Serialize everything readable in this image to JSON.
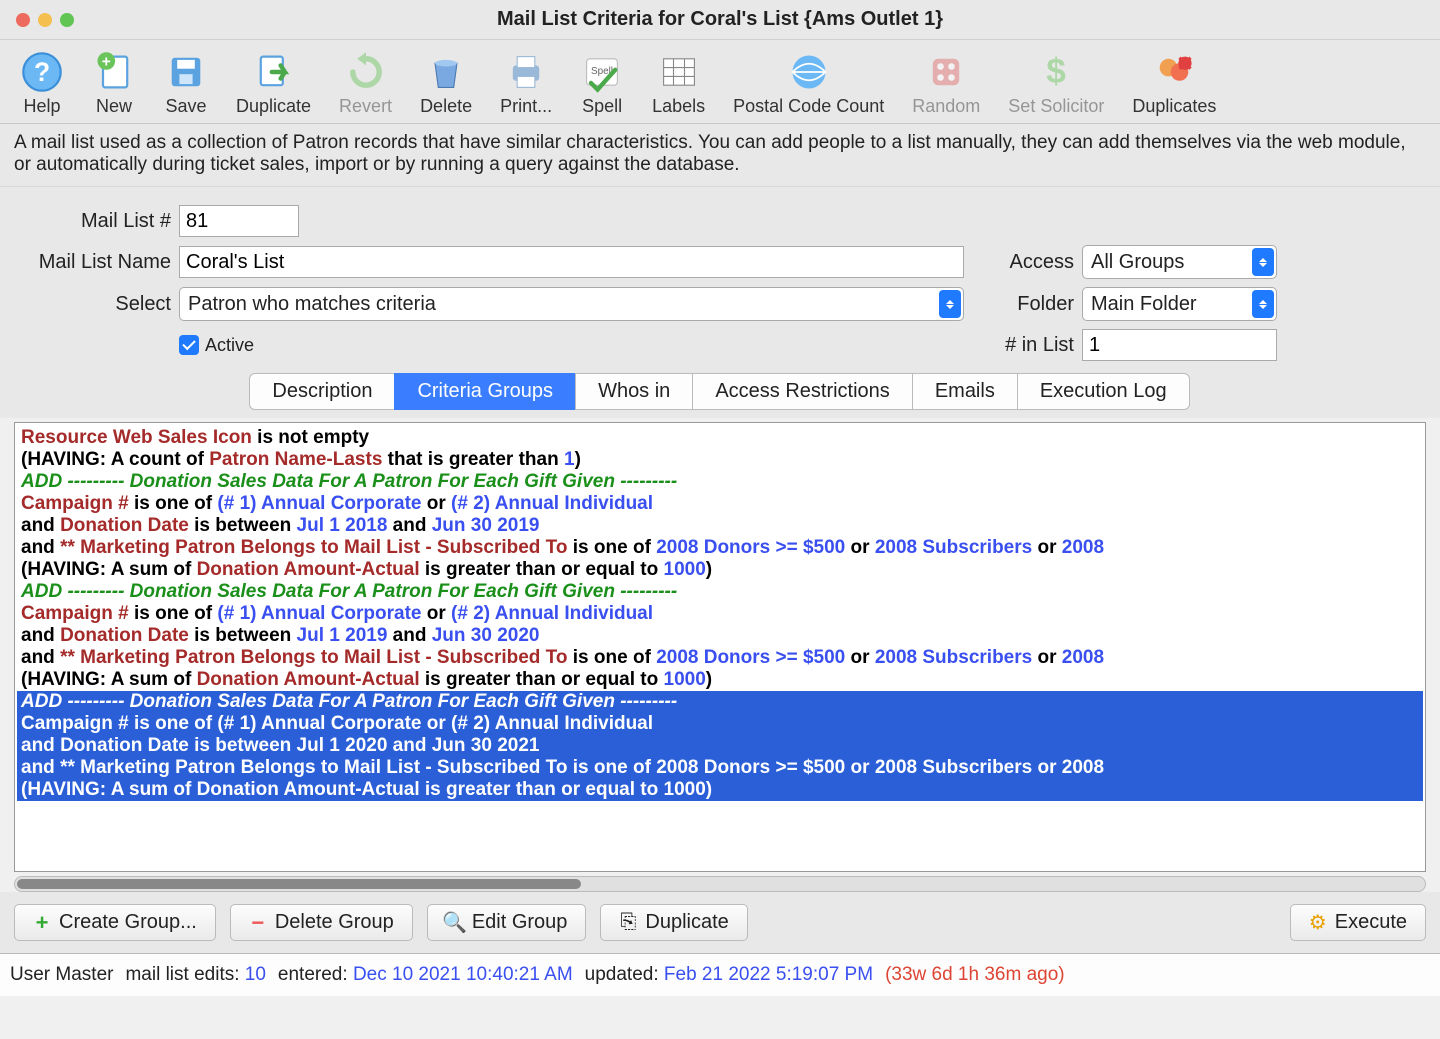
{
  "window": {
    "title": "Mail List Criteria for Coral's List {Ams Outlet 1}"
  },
  "toolbar": [
    {
      "id": "help",
      "label": "Help",
      "disabled": false
    },
    {
      "id": "new",
      "label": "New",
      "disabled": false
    },
    {
      "id": "save",
      "label": "Save",
      "disabled": false
    },
    {
      "id": "duplicate",
      "label": "Duplicate",
      "disabled": false
    },
    {
      "id": "revert",
      "label": "Revert",
      "disabled": true
    },
    {
      "id": "delete",
      "label": "Delete",
      "disabled": false
    },
    {
      "id": "print",
      "label": "Print...",
      "disabled": false
    },
    {
      "id": "spell",
      "label": "Spell",
      "disabled": false
    },
    {
      "id": "labels",
      "label": "Labels",
      "disabled": false
    },
    {
      "id": "postal",
      "label": "Postal Code Count",
      "disabled": false
    },
    {
      "id": "random",
      "label": "Random",
      "disabled": true
    },
    {
      "id": "setsolicitor",
      "label": "Set Solicitor",
      "disabled": true
    },
    {
      "id": "duplicates",
      "label": "Duplicates",
      "disabled": false
    }
  ],
  "description": "A mail list used as a collection of Patron records that have similar characteristics.   You can add people to a list manually, they can add themselves via the web module, or automatically during ticket sales, import or by running a query against the database.",
  "form": {
    "mail_list_num_label": "Mail List #",
    "mail_list_num": "81",
    "mail_list_name_label": "Mail List Name",
    "mail_list_name": "Coral's List",
    "select_label": "Select",
    "select_value": "Patron who matches criteria",
    "access_label": "Access",
    "access_value": "All Groups",
    "folder_label": "Folder",
    "folder_value": "Main Folder",
    "active_label": "Active",
    "active_checked": true,
    "inlist_label": "# in List",
    "inlist_value": "1"
  },
  "tabs": [
    "Description",
    "Criteria Groups",
    "Whos in",
    "Access Restrictions",
    "Emails",
    "Execution Log"
  ],
  "active_tab": "Criteria Groups",
  "criteria_lines": [
    {
      "sel": false,
      "parts": [
        {
          "c": "brown",
          "t": "Resource Web Sales Icon"
        },
        {
          "c": "black",
          "t": " is not empty"
        }
      ]
    },
    {
      "sel": false,
      "parts": [
        {
          "c": "black",
          "t": "("
        },
        {
          "c": "black",
          "t": "HAVING:"
        },
        {
          "c": "black",
          "t": " A count of "
        },
        {
          "c": "brown",
          "t": "Patron Name-Lasts"
        },
        {
          "c": "black",
          "t": " that is greater than "
        },
        {
          "c": "blue",
          "t": "1"
        },
        {
          "c": "black",
          "t": ")"
        }
      ]
    },
    {
      "sel": false,
      "parts": [
        {
          "c": "green",
          "t": "ADD"
        },
        {
          "c": "green",
          "t": "     ---------  Donation Sales Data For A Patron For Each Gift Given ---------"
        }
      ]
    },
    {
      "sel": false,
      "parts": [
        {
          "c": "brown",
          "t": "Campaign #"
        },
        {
          "c": "black",
          "t": " is one of "
        },
        {
          "c": "blue",
          "t": "(# 1) Annual Corporate"
        },
        {
          "c": "black",
          "t": " or "
        },
        {
          "c": "blue",
          "t": "(# 2) Annual Individual"
        }
      ]
    },
    {
      "sel": false,
      "parts": [
        {
          "c": "black",
          "t": "and "
        },
        {
          "c": "brown",
          "t": "Donation Date"
        },
        {
          "c": "black",
          "t": " is between "
        },
        {
          "c": "blue",
          "t": "Jul 1 2018"
        },
        {
          "c": "black",
          "t": " and "
        },
        {
          "c": "blue",
          "t": "Jun 30 2019"
        }
      ]
    },
    {
      "sel": false,
      "parts": [
        {
          "c": "black",
          "t": "and "
        },
        {
          "c": "brown",
          "t": "** Marketing Patron Belongs to Mail List - Subscribed To"
        },
        {
          "c": "black",
          "t": " is one of "
        },
        {
          "c": "blue",
          "t": "2008 Donors >= $500"
        },
        {
          "c": "black",
          "t": " or "
        },
        {
          "c": "blue",
          "t": "2008 Subscribers"
        },
        {
          "c": "black",
          "t": " or "
        },
        {
          "c": "blue",
          "t": "2008"
        }
      ]
    },
    {
      "sel": false,
      "parts": [
        {
          "c": "black",
          "t": "("
        },
        {
          "c": "black",
          "t": "HAVING:"
        },
        {
          "c": "black",
          "t": " A sum of "
        },
        {
          "c": "brown",
          "t": "Donation Amount-Actual"
        },
        {
          "c": "black",
          "t": " is greater than or equal to "
        },
        {
          "c": "blue",
          "t": "1000"
        },
        {
          "c": "black",
          "t": ")"
        }
      ]
    },
    {
      "sel": false,
      "parts": [
        {
          "c": "green",
          "t": "ADD"
        },
        {
          "c": "green",
          "t": "     ---------  Donation Sales Data For A Patron For Each Gift Given ---------"
        }
      ]
    },
    {
      "sel": false,
      "parts": [
        {
          "c": "brown",
          "t": "Campaign #"
        },
        {
          "c": "black",
          "t": " is one of "
        },
        {
          "c": "blue",
          "t": "(# 1) Annual Corporate"
        },
        {
          "c": "black",
          "t": " or "
        },
        {
          "c": "blue",
          "t": "(# 2) Annual Individual"
        }
      ]
    },
    {
      "sel": false,
      "parts": [
        {
          "c": "black",
          "t": "and "
        },
        {
          "c": "brown",
          "t": "Donation Date"
        },
        {
          "c": "black",
          "t": " is between "
        },
        {
          "c": "blue",
          "t": "Jul 1 2019"
        },
        {
          "c": "black",
          "t": " and "
        },
        {
          "c": "blue",
          "t": "Jun 30 2020"
        }
      ]
    },
    {
      "sel": false,
      "parts": [
        {
          "c": "black",
          "t": "and "
        },
        {
          "c": "brown",
          "t": "** Marketing Patron Belongs to Mail List - Subscribed To"
        },
        {
          "c": "black",
          "t": " is one of "
        },
        {
          "c": "blue",
          "t": "2008 Donors >= $500"
        },
        {
          "c": "black",
          "t": " or "
        },
        {
          "c": "blue",
          "t": "2008 Subscribers"
        },
        {
          "c": "black",
          "t": " or "
        },
        {
          "c": "blue",
          "t": "2008"
        }
      ]
    },
    {
      "sel": false,
      "parts": [
        {
          "c": "black",
          "t": "("
        },
        {
          "c": "black",
          "t": "HAVING:"
        },
        {
          "c": "black",
          "t": " A sum of "
        },
        {
          "c": "brown",
          "t": "Donation Amount-Actual"
        },
        {
          "c": "black",
          "t": " is greater than or equal to "
        },
        {
          "c": "blue",
          "t": "1000"
        },
        {
          "c": "black",
          "t": ")"
        }
      ]
    },
    {
      "sel": true,
      "parts": [
        {
          "c": "green",
          "t": "ADD"
        },
        {
          "c": "green",
          "t": "     ---------  Donation Sales Data For A Patron For Each Gift Given ---------"
        }
      ]
    },
    {
      "sel": true,
      "parts": [
        {
          "c": "brown",
          "t": "Campaign #"
        },
        {
          "c": "black",
          "t": " is one of "
        },
        {
          "c": "blue",
          "t": "(# 1) Annual Corporate"
        },
        {
          "c": "black",
          "t": " or "
        },
        {
          "c": "blue",
          "t": "(# 2) Annual Individual"
        }
      ]
    },
    {
      "sel": true,
      "parts": [
        {
          "c": "black",
          "t": "and "
        },
        {
          "c": "brown",
          "t": "Donation Date"
        },
        {
          "c": "black",
          "t": " is between "
        },
        {
          "c": "blue",
          "t": "Jul 1 2020"
        },
        {
          "c": "black",
          "t": " and "
        },
        {
          "c": "blue",
          "t": "Jun 30 2021"
        }
      ]
    },
    {
      "sel": true,
      "parts": [
        {
          "c": "black",
          "t": "and "
        },
        {
          "c": "brown",
          "t": "** Marketing Patron Belongs to Mail List - Subscribed To"
        },
        {
          "c": "black",
          "t": " is one of "
        },
        {
          "c": "blue",
          "t": "2008 Donors >= $500"
        },
        {
          "c": "black",
          "t": " or "
        },
        {
          "c": "blue",
          "t": "2008 Subscribers"
        },
        {
          "c": "black",
          "t": " or "
        },
        {
          "c": "blue",
          "t": "2008"
        }
      ]
    },
    {
      "sel": true,
      "parts": [
        {
          "c": "black",
          "t": "("
        },
        {
          "c": "black",
          "t": "HAVING:"
        },
        {
          "c": "black",
          "t": " A sum of "
        },
        {
          "c": "brown",
          "t": "Donation Amount-Actual"
        },
        {
          "c": "black",
          "t": " is greater than or equal to "
        },
        {
          "c": "blue",
          "t": "1000"
        },
        {
          "c": "black",
          "t": ")"
        }
      ]
    }
  ],
  "group_buttons": {
    "create": "Create Group...",
    "delete": "Delete Group",
    "edit": "Edit Group",
    "duplicate": "Duplicate",
    "execute": "Execute"
  },
  "status": {
    "user": "User Master",
    "edits_label": "mail list edits:",
    "edits_val": "10",
    "entered_label": "entered:",
    "entered_val": "Dec 10 2021 10:40:21 AM",
    "updated_label": "updated:",
    "updated_val": "Feb 21 2022 5:19:07 PM",
    "ago": "(33w 6d 1h 36m ago)"
  },
  "icons": {
    "help": "?",
    "new": "+",
    "save": "💾",
    "duplicate": "➡",
    "revert": "↻",
    "delete": "🗑",
    "print": "🖨",
    "spell": "✓",
    "labels": "▤",
    "postal": "🌐",
    "random": "🎲",
    "setsolicitor": "$",
    "duplicates": "👥"
  }
}
